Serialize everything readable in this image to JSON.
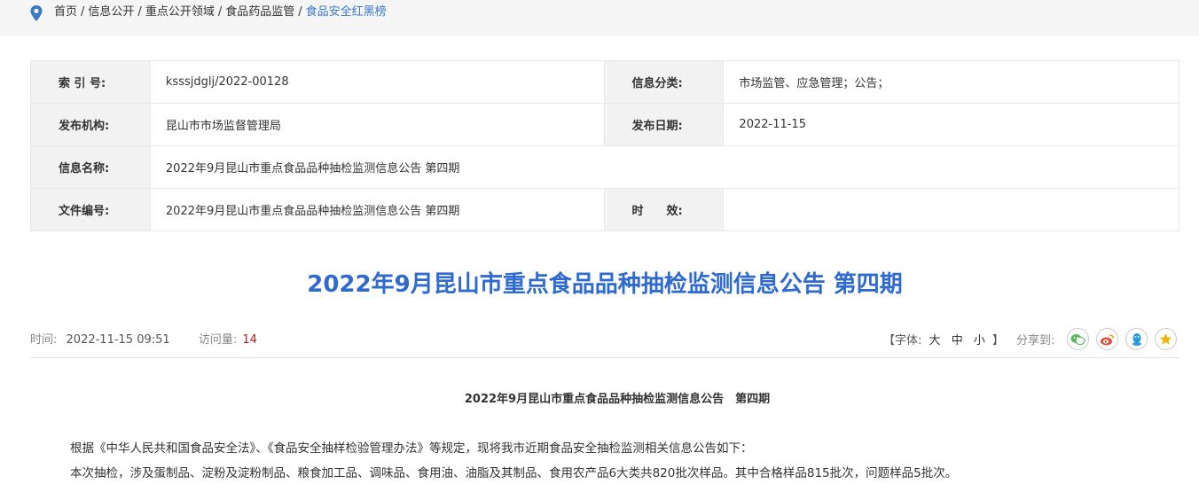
{
  "breadcrumb": {
    "items": [
      "首页",
      "信息公开",
      "重点公开领域",
      "食品药品监管",
      "食品安全红黑榜"
    ],
    "separator": "/"
  },
  "meta": {
    "index_label": "索 引 号:",
    "index_value": "ksssjdglj/2022-00128",
    "category_label": "信息分类:",
    "category_value": "市场监管、应急管理；公告；",
    "publisher_label": "发布机构:",
    "publisher_value": "昆山市市场监督管理局",
    "date_label": "发布日期:",
    "date_value": "2022-11-15",
    "name_label": "信息名称:",
    "name_value": "2022年9月昆山市重点食品品种抽检监测信息公告 第四期",
    "doc_label": "文件编号:",
    "doc_value": "2022年9月昆山市重点食品品种抽检监测信息公告 第四期",
    "validity_label": "时　　效:",
    "validity_value": ""
  },
  "article": {
    "title": "2022年9月昆山市重点食品品种抽检监测信息公告 第四期",
    "time_label": "时间:",
    "time_value": "2022-11-15 09:51",
    "views_label": "访问量:",
    "views_value": "14",
    "font_label_open": "【字体:",
    "font_large": "大",
    "font_medium": "中",
    "font_small": "小",
    "font_label_close": "】",
    "share_label": "分享到:",
    "body_title": "2022年9月昆山市重点食品品种抽检监测信息公告　第四期",
    "paragraphs": [
      "根据《中华人民共和国食品安全法》、《食品安全抽样检验管理办法》等规定，现将我市近期食品安全抽检监测相关信息公告如下：",
      "本次抽检，涉及蛋制品、淀粉及淀粉制品、粮食加工品、调味品、食用油、油脂及其制品、食用农产品6大类共820批次样品。其中合格样品815批次，问题样品5批次。"
    ]
  },
  "colors": {
    "title_blue": "#2f6bcf",
    "breadcrumb_current": "#3a78c8",
    "views_red": "#b51a1a",
    "wechat_green": "#5cb85c",
    "weibo_red": "#e74c3c",
    "qq_blue": "#2b9bd8",
    "qzone_yellow": "#f0b400"
  },
  "icons": [
    "location-pin-icon",
    "wechat-icon",
    "weibo-icon",
    "qq-icon",
    "qzone-icon"
  ]
}
